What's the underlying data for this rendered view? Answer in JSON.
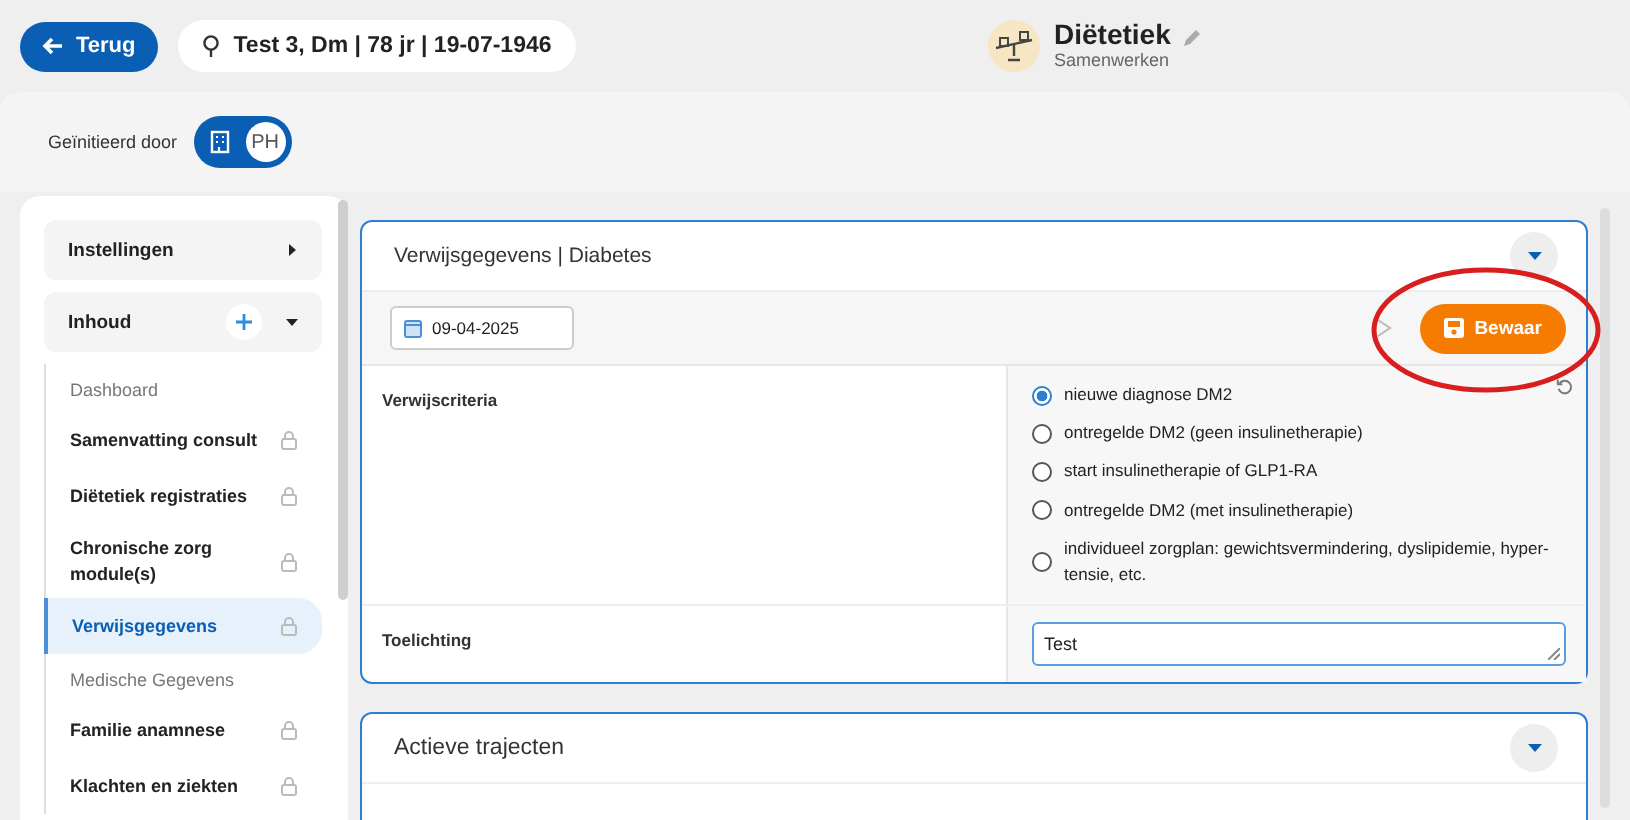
{
  "header": {
    "back_button": "Terug",
    "patient": "Test 3, Dm | 78 jr | 19-07-1946",
    "module_title": "Diëtetiek",
    "module_subtitle": "Samenwerken"
  },
  "initiated_by": {
    "label": "Geïnitieerd door",
    "options": [
      {
        "kind": "building",
        "selected": false
      },
      {
        "kind": "initials",
        "label": "PH",
        "selected": true
      }
    ]
  },
  "sidebar": {
    "sections": [
      {
        "label": "Instellingen",
        "expanded": false,
        "can_add": false
      },
      {
        "label": "Inhoud",
        "expanded": true,
        "can_add": true
      }
    ],
    "groups": [
      {
        "label": "Dashboard",
        "items": [
          {
            "label": "Samenvatting consult",
            "selected": false,
            "locked": true
          },
          {
            "label": "Diëtetiek registraties",
            "selected": false,
            "locked": true
          },
          {
            "label": "Chronische zorg module(s)",
            "selected": false,
            "locked": true
          },
          {
            "label": "Verwijsgegevens",
            "selected": true,
            "locked": true
          }
        ]
      },
      {
        "label": "Medische Gegevens",
        "items": [
          {
            "label": "Familie anamnese",
            "selected": false,
            "locked": true
          },
          {
            "label": "Klachten en ziekten",
            "selected": false,
            "locked": true
          }
        ]
      }
    ]
  },
  "form": {
    "title": "Verwijsgegevens | Diabetes",
    "date": "09-04-2025",
    "save_button": "Bewaar",
    "fields": [
      {
        "label": "Verwijscriteria",
        "kind": "radio",
        "options": [
          {
            "label": "nieuwe diagnose DM2",
            "selected": true
          },
          {
            "label": "ontregelde DM2 (geen insulinetherapie)",
            "selected": false
          },
          {
            "label": "start insulinetherapie of GLP1-RA",
            "selected": false
          },
          {
            "label": "ontregelde DM2 (met insulinetherapie)",
            "selected": false
          },
          {
            "label": "individueel zorgplan: gewichtsvermindering, dyslipidemie, hyper-tensie, etc.",
            "selected": false
          }
        ]
      },
      {
        "label": "Toelichting",
        "kind": "text",
        "value": "Test"
      }
    ]
  },
  "second_panel": {
    "title": "Actieve trajecten"
  },
  "annotation": {
    "kind": "ellipse"
  }
}
